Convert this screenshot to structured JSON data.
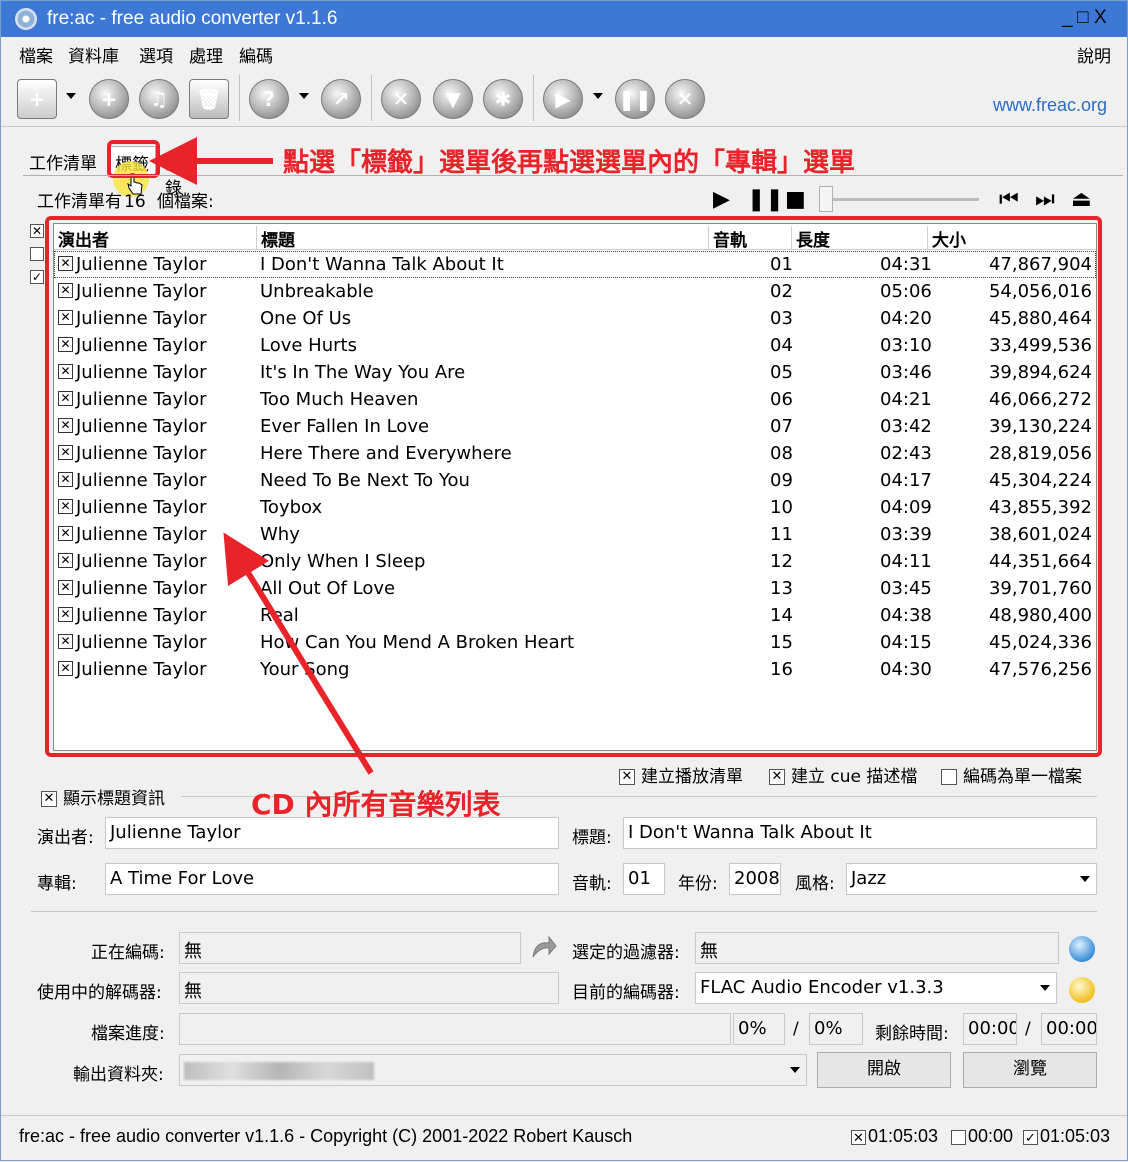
{
  "window": {
    "title": "fre:ac - free audio converter v1.1.6",
    "minimize": "_",
    "maximize": "□",
    "close": "X"
  },
  "menu": {
    "items": [
      "檔案",
      "資料庫",
      "選項",
      "處理",
      "編碼"
    ],
    "help": "說明"
  },
  "toolbar": {
    "link": "www.freac.org"
  },
  "tabs": {
    "joblist": "工作清單",
    "tags": "標籤",
    "log_partial": "記錄"
  },
  "annotations": {
    "top": "點選「標籤」選單後再點選選單內的「專輯」選單",
    "bottom": "CD 內所有音樂列表",
    "color": "#e8232a"
  },
  "joblist": {
    "status_prefix": "工作清單有",
    "count": "16",
    "status_suffix": "個檔案:",
    "columns": [
      "演出者",
      "標題",
      "音軌",
      "長度",
      "大小"
    ],
    "tracks": [
      {
        "artist": "Julienne Taylor",
        "title": "I Don't Wanna Talk About It",
        "track": "01",
        "length": "04:31",
        "size": "47,867,904"
      },
      {
        "artist": "Julienne Taylor",
        "title": "Unbreakable",
        "track": "02",
        "length": "05:06",
        "size": "54,056,016"
      },
      {
        "artist": "Julienne Taylor",
        "title": "One Of Us",
        "track": "03",
        "length": "04:20",
        "size": "45,880,464"
      },
      {
        "artist": "Julienne Taylor",
        "title": "Love Hurts",
        "track": "04",
        "length": "03:10",
        "size": "33,499,536"
      },
      {
        "artist": "Julienne Taylor",
        "title": "It's In The Way You Are",
        "track": "05",
        "length": "03:46",
        "size": "39,894,624"
      },
      {
        "artist": "Julienne Taylor",
        "title": "Too Much Heaven",
        "track": "06",
        "length": "04:21",
        "size": "46,066,272"
      },
      {
        "artist": "Julienne Taylor",
        "title": "Ever Fallen In Love",
        "track": "07",
        "length": "03:42",
        "size": "39,130,224"
      },
      {
        "artist": "Julienne Taylor",
        "title": "Here There and Everywhere",
        "track": "08",
        "length": "02:43",
        "size": "28,819,056"
      },
      {
        "artist": "Julienne Taylor",
        "title": "Need To Be Next To You",
        "track": "09",
        "length": "04:17",
        "size": "45,304,224"
      },
      {
        "artist": "Julienne Taylor",
        "title": "Toybox",
        "track": "10",
        "length": "04:09",
        "size": "43,855,392"
      },
      {
        "artist": "Julienne Taylor",
        "title": "Why",
        "track": "11",
        "length": "03:39",
        "size": "38,601,024"
      },
      {
        "artist": "Julienne Taylor",
        "title": "Only When I Sleep",
        "track": "12",
        "length": "04:11",
        "size": "44,351,664"
      },
      {
        "artist": "Julienne Taylor",
        "title": "All Out Of Love",
        "track": "13",
        "length": "03:45",
        "size": "39,701,760"
      },
      {
        "artist": "Julienne Taylor",
        "title": "Real",
        "track": "14",
        "length": "04:38",
        "size": "48,980,400"
      },
      {
        "artist": "Julienne Taylor",
        "title": "How Can You Mend A Broken Heart",
        "track": "15",
        "length": "04:15",
        "size": "45,024,336"
      },
      {
        "artist": "Julienne Taylor",
        "title": "Your Song",
        "track": "16",
        "length": "04:30",
        "size": "47,576,256"
      }
    ]
  },
  "options": {
    "playlist": "建立播放清單",
    "cue": "建立 cue 描述檔",
    "single": "編碼為單一檔案",
    "show_tags": "顯示標題資訊"
  },
  "taginfo": {
    "artist_label": "演出者:",
    "artist": "Julienne Taylor",
    "title_label": "標題:",
    "title": "I Don't Wanna Talk About It",
    "album_label": "專輯:",
    "album": "A Time For Love",
    "track_label": "音軌:",
    "track": "01",
    "year_label": "年份:",
    "year": "2008",
    "genre_label": "風格:",
    "genre": "Jazz"
  },
  "encoding": {
    "encoding_label": "正在編碼:",
    "encoding_value": "無",
    "filter_label": "選定的過濾器:",
    "filter_value": "無",
    "decoder_label": "使用中的解碼器:",
    "decoder_value": "無",
    "encoder_label": "目前的編碼器:",
    "encoder_value": "FLAC Audio Encoder v1.3.3",
    "progress_label": "檔案進度:",
    "progress_file": "0%",
    "slash": "/",
    "progress_total": "0%",
    "remaining_label": "剩餘時間:",
    "remaining_file": "00:00",
    "remaining_total": "00:00",
    "output_label": "輸出資料夾:",
    "open_button": "開啟",
    "browse_button": "瀏覽"
  },
  "footer": {
    "text": "fre:ac - free audio converter v1.1.6 - Copyright (C) 2001-2022 Robert Kausch",
    "selected_time": "01:05:03",
    "unselected_time": "00:00",
    "total_time": "01:05:03"
  }
}
